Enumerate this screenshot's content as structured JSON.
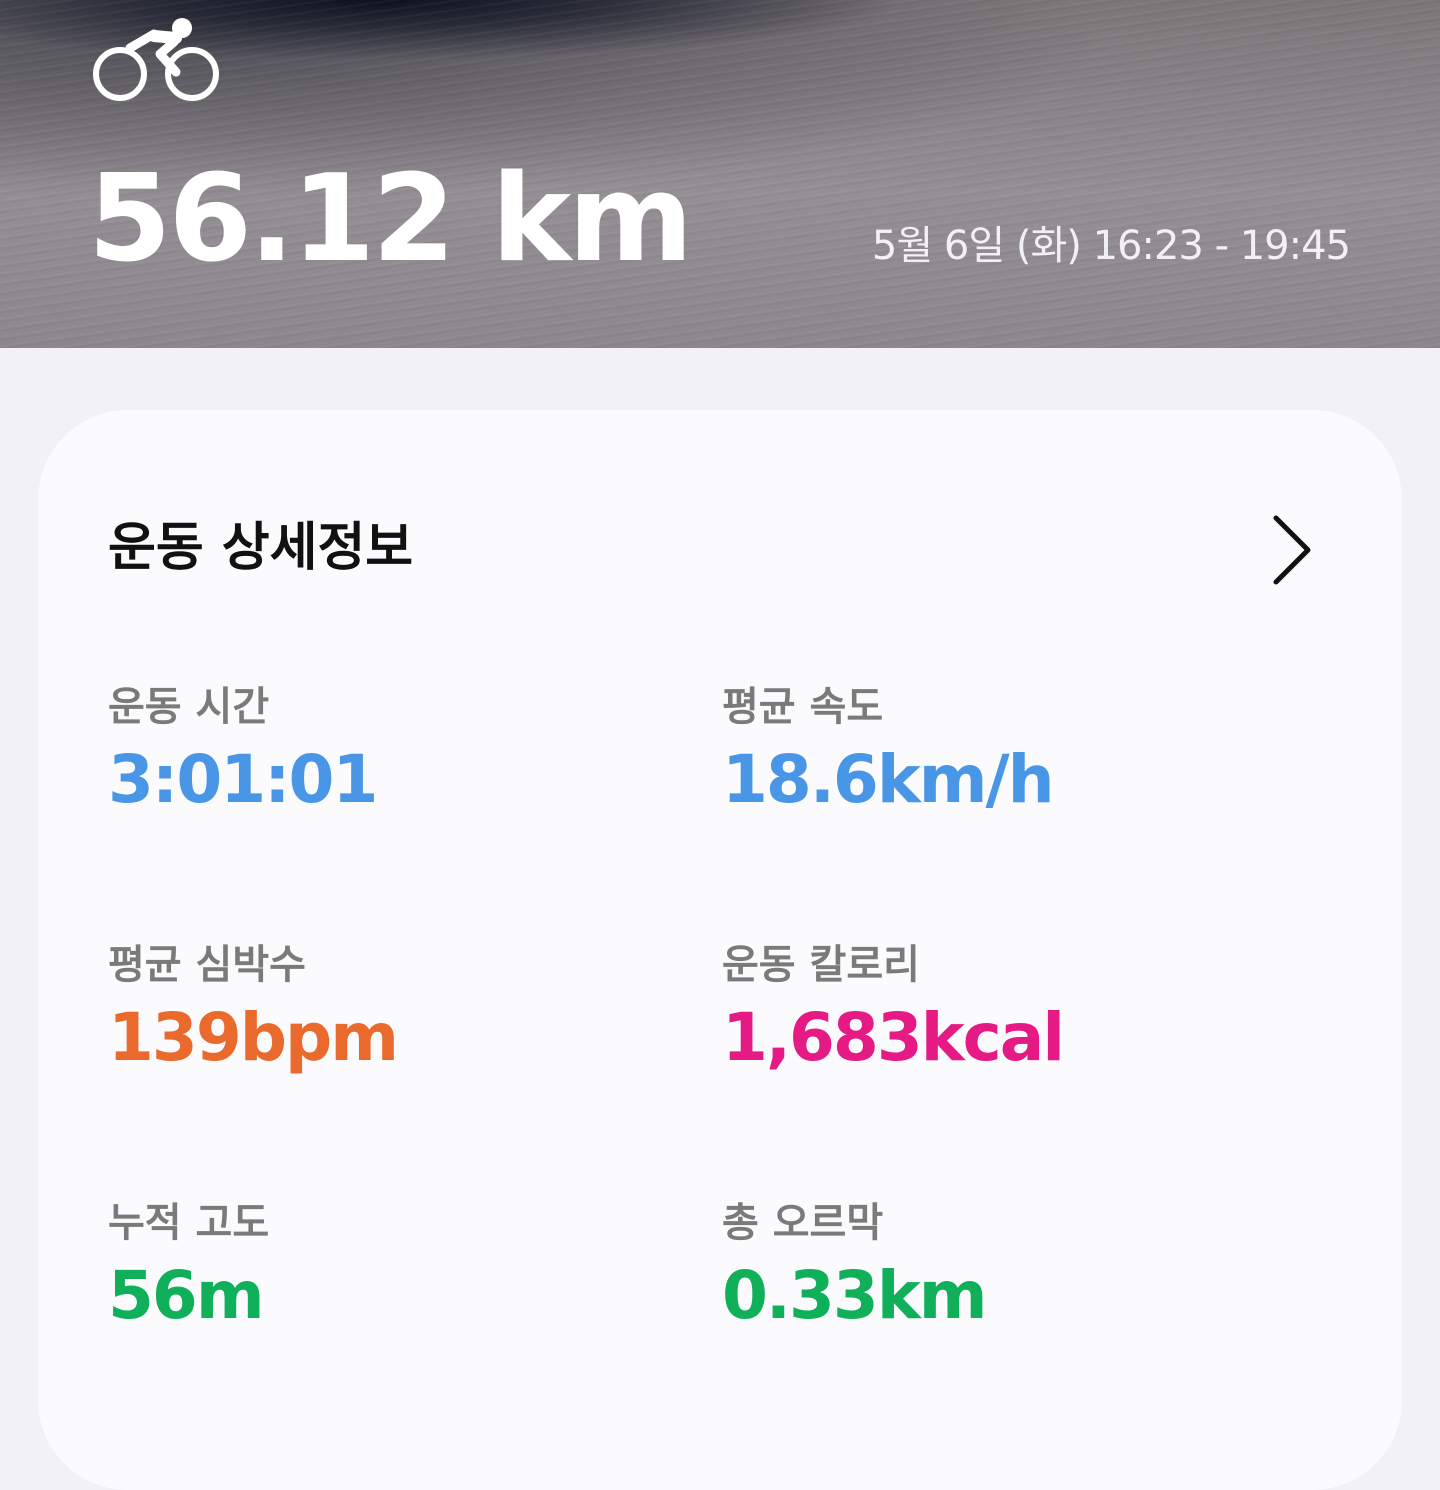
{
  "header": {
    "activity_icon": "cycling-icon",
    "distance": "56.12 km",
    "datetime": "5월 6일 (화) 16:23 - 19:45"
  },
  "details": {
    "title": "운동 상세정보",
    "chevron_icon": "chevron-right-icon",
    "stats": [
      {
        "label": "운동 시간",
        "value": "3:01:01",
        "color": "#4a96e6"
      },
      {
        "label": "평균 속도",
        "value": "18.6km/h",
        "color": "#4a96e6"
      },
      {
        "label": "평균 심박수",
        "value": "139bpm",
        "color": "#ea6a2e"
      },
      {
        "label": "운동 칼로리",
        "value": "1,683kcal",
        "color": "#e61a84"
      },
      {
        "label": "누적 고도",
        "value": "56m",
        "color": "#10b05a"
      },
      {
        "label": "총 오르막",
        "value": "0.33km",
        "color": "#10b05a"
      }
    ]
  }
}
